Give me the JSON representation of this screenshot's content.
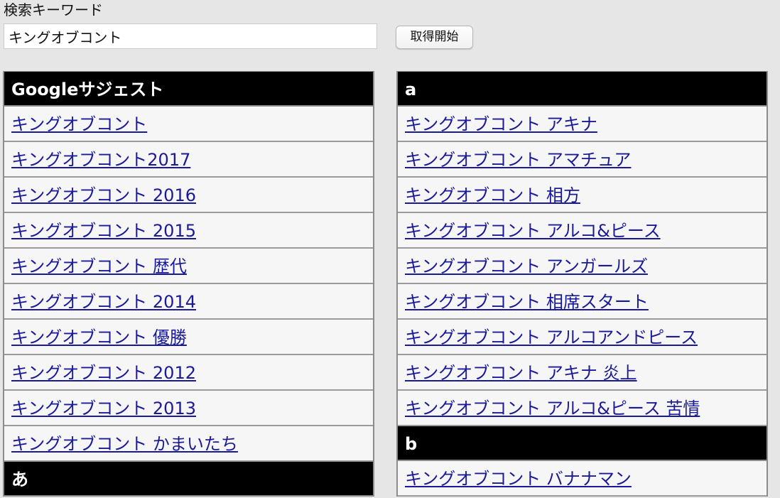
{
  "search": {
    "label": "検索キーワード",
    "value": "キングオブコント",
    "button_label": "取得開始"
  },
  "left_panel": {
    "header": "Googleサジェスト",
    "items": [
      "キングオブコント",
      "キングオブコント2017",
      "キングオブコント 2016",
      "キングオブコント 2015",
      "キングオブコント 歴代",
      "キングオブコント 2014",
      "キングオブコント 優勝",
      "キングオブコント 2012",
      "キングオブコント 2013",
      "キングオブコント かまいたち"
    ],
    "next_header": "あ"
  },
  "right_panel": {
    "header": "a",
    "items": [
      "キングオブコント アキナ",
      "キングオブコント アマチュア",
      "キングオブコント 相方",
      "キングオブコント アルコ&ピース",
      "キングオブコント アンガールズ",
      "キングオブコント 相席スタート",
      "キングオブコント アルコアンドピース",
      "キングオブコント アキナ 炎上",
      "キングオブコント アルコ&ピース 苦情"
    ],
    "next_header": "b",
    "next_items": [
      "キングオブコント バナナマン"
    ]
  }
}
